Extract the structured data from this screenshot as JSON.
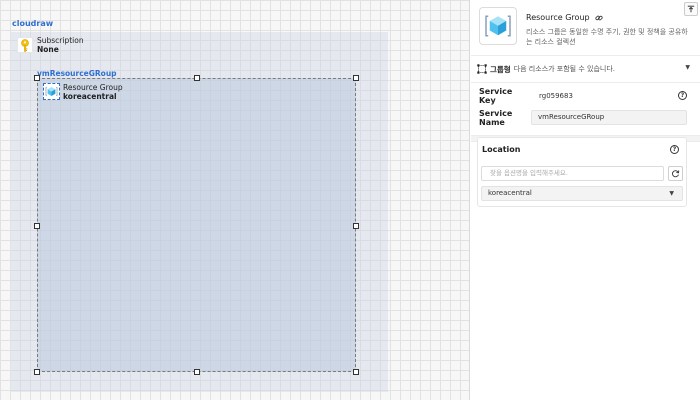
{
  "canvas": {
    "title": "cloudraw",
    "subscription": {
      "type_label": "Subscription",
      "value": "None",
      "icon": "key-icon"
    },
    "resource_group_box": {
      "title": "vmResourceGRoup",
      "node": {
        "type_label": "Resource Group",
        "location": "koreacentral",
        "icon": "resource-group-cube-icon"
      }
    }
  },
  "panel": {
    "header": {
      "title": "Resource Group",
      "description": "리소스 그룹은 동일한 수명 주기, 권한 및 정책을 공유하는 리소스 컬렉션",
      "link_icon": "link-icon",
      "pin_icon": "collapse-top-icon"
    },
    "group_row": {
      "label": "그룹형",
      "description": "다음 리소스가 포함될 수 있습니다.",
      "icon": "group-frame-icon"
    },
    "fields": {
      "service_key_label": "Service Key",
      "service_key_value": "rg059683",
      "service_name_label": "Service Name",
      "service_name_value": "vmResourceGRoup"
    },
    "location": {
      "title": "Location",
      "search_placeholder": "찾을 옵션명을 입력해주세요.",
      "selected": "koreacentral"
    }
  },
  "colors": {
    "accent_blue": "#2f6fd1",
    "canvas_bg": "#f7f7f7",
    "rg_area": "#bac8dc",
    "cube_light": "#7fd3f5",
    "cube_dark": "#2a9fd8"
  }
}
